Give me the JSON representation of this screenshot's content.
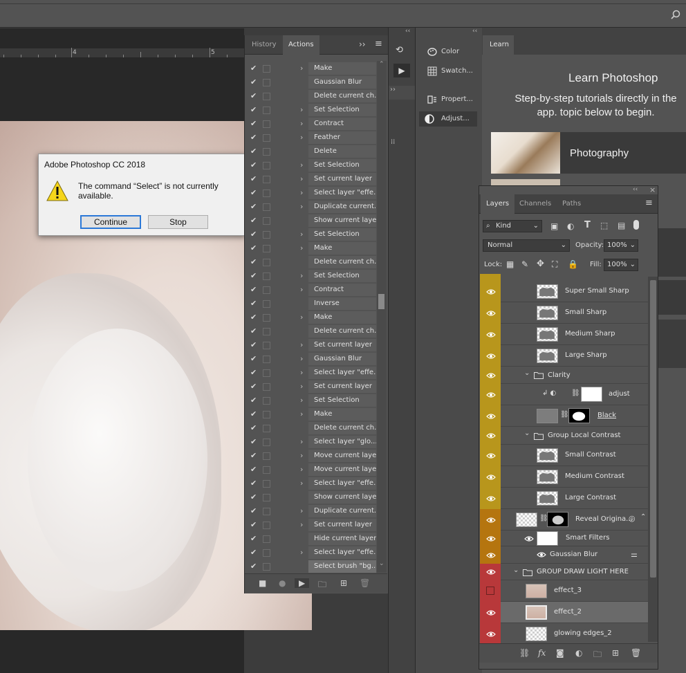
{
  "ruler": {
    "mark1": "4",
    "mark2": "5"
  },
  "dialog": {
    "title": "Adobe Photoshop CC 2018",
    "message": "The command “Select” is not currently available.",
    "continue_label": "Continue",
    "stop_label": "Stop"
  },
  "actions_panel": {
    "tabs": [
      "History",
      "Actions"
    ],
    "active_tab": "Actions",
    "steps": [
      {
        "label": "Make",
        "expand": true
      },
      {
        "label": "Gaussian Blur",
        "expand": false
      },
      {
        "label": "Delete current ch...",
        "expand": false
      },
      {
        "label": "Set Selection",
        "expand": true
      },
      {
        "label": "Contract",
        "expand": true
      },
      {
        "label": "Feather",
        "expand": true
      },
      {
        "label": "Delete",
        "expand": false
      },
      {
        "label": "Set Selection",
        "expand": true
      },
      {
        "label": "Set current layer",
        "expand": true
      },
      {
        "label": "Select layer \"effe...",
        "expand": true
      },
      {
        "label": "Duplicate current...",
        "expand": true
      },
      {
        "label": "Show current layer",
        "expand": false
      },
      {
        "label": "Set Selection",
        "expand": true
      },
      {
        "label": "Make",
        "expand": true
      },
      {
        "label": "Delete current ch...",
        "expand": false
      },
      {
        "label": "Set Selection",
        "expand": true
      },
      {
        "label": "Contract",
        "expand": true
      },
      {
        "label": "Inverse",
        "expand": false
      },
      {
        "label": "Make",
        "expand": true
      },
      {
        "label": "Delete current ch...",
        "expand": false
      },
      {
        "label": "Set current layer",
        "expand": true
      },
      {
        "label": "Gaussian Blur",
        "expand": true
      },
      {
        "label": "Select layer \"effe...",
        "expand": true
      },
      {
        "label": "Set current layer",
        "expand": true
      },
      {
        "label": "Set Selection",
        "expand": true
      },
      {
        "label": "Make",
        "expand": true
      },
      {
        "label": "Delete current ch...",
        "expand": false
      },
      {
        "label": "Select layer \"glo...",
        "expand": true
      },
      {
        "label": "Move current layer",
        "expand": true
      },
      {
        "label": "Move current layer",
        "expand": true
      },
      {
        "label": "Select layer \"effe...",
        "expand": true
      },
      {
        "label": "Show current layer",
        "expand": false
      },
      {
        "label": "Duplicate current...",
        "expand": true
      },
      {
        "label": "Set current layer",
        "expand": true
      },
      {
        "label": "Hide current layer",
        "expand": false
      },
      {
        "label": "Select layer \"effe...",
        "expand": true
      },
      {
        "label": "Select brush \"bg...",
        "expand": false
      }
    ]
  },
  "side_panel": {
    "items": [
      "Color",
      "Swatch...",
      "Propert...",
      "Adjust..."
    ]
  },
  "learn": {
    "tab": "Learn",
    "title": "Learn Photoshop",
    "subtitle": "Step-by-step tutorials directly in the app. topic below to begin.",
    "card_label": "Photography"
  },
  "layers_panel": {
    "tabs": [
      "Layers",
      "Channels",
      "Paths"
    ],
    "kind_label": "Kind",
    "blend_mode": "Normal",
    "opacity_label": "Opacity:",
    "opacity_value": "100%",
    "lock_label": "Lock:",
    "fill_label": "Fill:",
    "fill_value": "100%",
    "colors": {
      "yellow": "#b8961c",
      "orange": "#b5750f",
      "red": "#b8383a"
    },
    "layers": [
      {
        "name": "Super Small Sharp",
        "color": "yellow",
        "type": "layer"
      },
      {
        "name": "Small Sharp",
        "color": "yellow",
        "type": "layer"
      },
      {
        "name": "Medium Sharp",
        "color": "yellow",
        "type": "layer"
      },
      {
        "name": "Large Sharp",
        "color": "yellow",
        "type": "layer"
      },
      {
        "name": "Clarity",
        "color": "yellow",
        "type": "group"
      },
      {
        "name": "adjust",
        "color": "yellow",
        "type": "adjust"
      },
      {
        "name": "Black",
        "color": "yellow",
        "type": "mask"
      },
      {
        "name": "Group Local Contrast",
        "color": "yellow",
        "type": "group"
      },
      {
        "name": "Small Contrast",
        "color": "yellow",
        "type": "layer"
      },
      {
        "name": "Medium Contrast",
        "color": "yellow",
        "type": "layer"
      },
      {
        "name": "Large Contrast",
        "color": "yellow",
        "type": "layer"
      },
      {
        "name": "Reveal Origina...",
        "color": "orange",
        "type": "smart"
      },
      {
        "name": "Smart Filters",
        "color": "orange",
        "type": "filter"
      },
      {
        "name": "Gaussian Blur",
        "color": "orange",
        "type": "filteritem"
      },
      {
        "name": "GROUP DRAW LIGHT HERE",
        "color": "red",
        "type": "group"
      },
      {
        "name": "effect_3",
        "color": "red",
        "type": "photo"
      },
      {
        "name": "effect_2",
        "color": "red",
        "type": "photo"
      },
      {
        "name": "glowing edges_2",
        "color": "red",
        "type": "layer"
      }
    ]
  }
}
